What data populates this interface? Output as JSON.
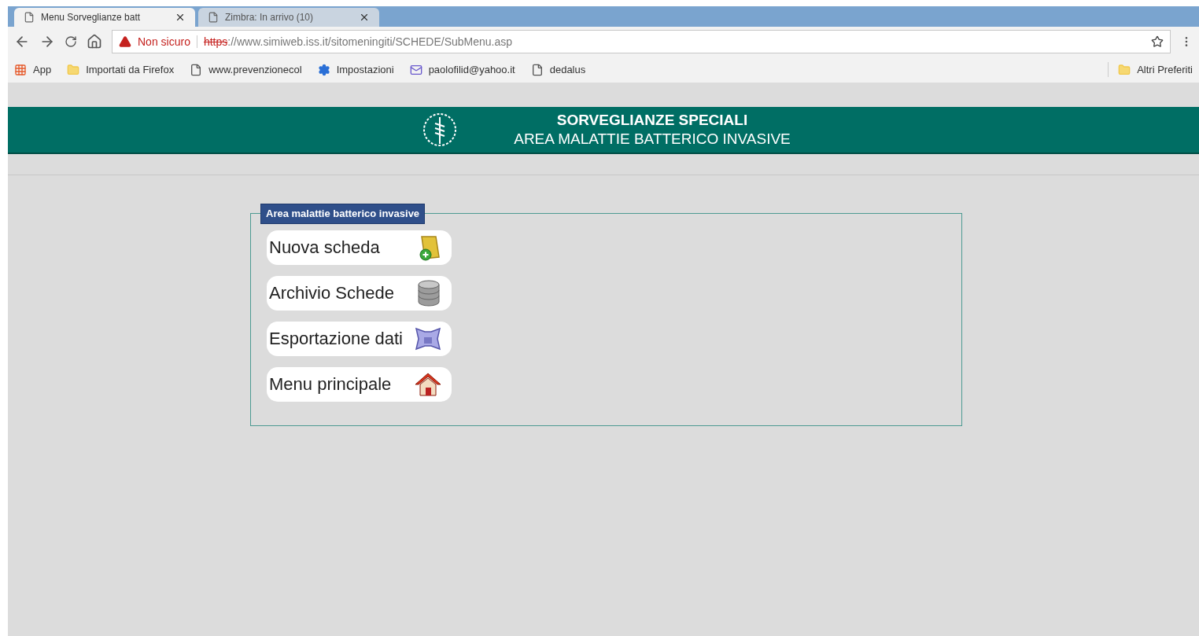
{
  "tabs": [
    {
      "title": "Menu Sorveglianze batt",
      "selected": true
    },
    {
      "title": "Zimbra: In arrivo (10)",
      "selected": false
    }
  ],
  "address_bar": {
    "security": "Non sicuro",
    "scheme": "https",
    "url": "://www.simiweb.iss.it/sitomeningiti/SCHEDE/SubMenu.asp"
  },
  "bookmarks": [
    {
      "label": "App",
      "kind": "apps"
    },
    {
      "label": "Importati da Firefox",
      "kind": "folder"
    },
    {
      "label": "www.prevenzionecol",
      "kind": "page"
    },
    {
      "label": "Impostazioni",
      "kind": "gear"
    },
    {
      "label": "paolofilid@yahoo.it",
      "kind": "mail"
    },
    {
      "label": "dedalus",
      "kind": "page"
    }
  ],
  "other_bookmarks": "Altri Preferiti",
  "header": {
    "title": "SORVEGLIANZE SPECIALI",
    "subtitle": "AREA MALATTIE BATTERICO INVASIVE"
  },
  "panel": {
    "legend": "Area malattie batterico invasive",
    "items": [
      {
        "label": "Nuova scheda",
        "kind": "new"
      },
      {
        "label": "Archivio Schede",
        "kind": "archive"
      },
      {
        "label": "Esportazione dati",
        "kind": "export"
      },
      {
        "label": "Menu principale",
        "kind": "home"
      }
    ]
  }
}
